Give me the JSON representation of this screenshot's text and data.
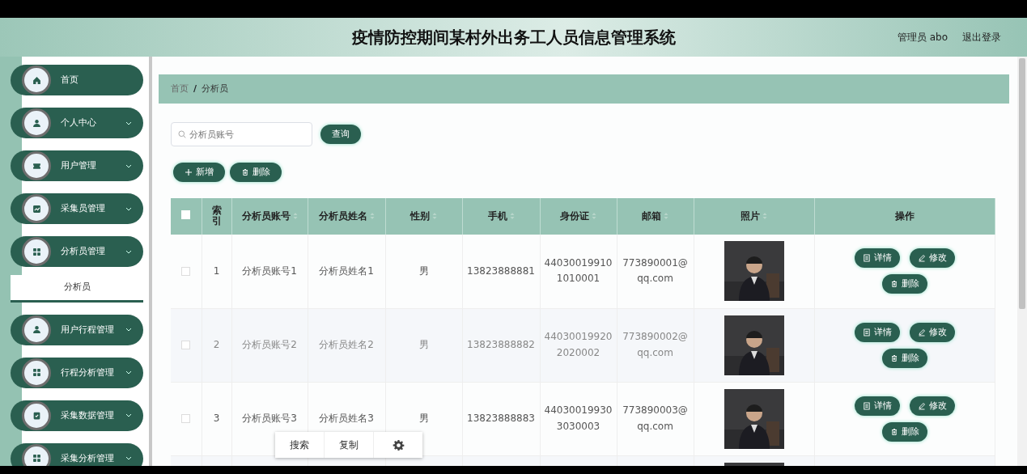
{
  "header": {
    "title": "疫情防控期间某村外出务工人员信息管理系统",
    "user": "管理员 abo",
    "logout": "退出登录"
  },
  "sidebar": {
    "items": [
      {
        "label": "首页",
        "kind": "home",
        "expandable": false
      },
      {
        "label": "个人中心",
        "kind": "user",
        "expandable": true
      },
      {
        "label": "用户管理",
        "kind": "ticket",
        "expandable": true
      },
      {
        "label": "采集员管理",
        "kind": "chart",
        "expandable": true
      },
      {
        "label": "分析员管理",
        "kind": "grid",
        "expandable": true,
        "children": [
          {
            "label": "分析员",
            "selected": true
          }
        ]
      },
      {
        "label": "用户行程管理",
        "kind": "user",
        "expandable": true
      },
      {
        "label": "行程分析管理",
        "kind": "grid",
        "expandable": true
      },
      {
        "label": "采集数据管理",
        "kind": "clipboard",
        "expandable": true
      },
      {
        "label": "采集分析管理",
        "kind": "grid",
        "expandable": true
      }
    ]
  },
  "breadcrumb": {
    "items": [
      "首页",
      "分析员"
    ],
    "separator": "/"
  },
  "search": {
    "placeholder": "分析员账号",
    "button": "查询"
  },
  "toolbar": [
    {
      "kind": "add",
      "label": "新增"
    },
    {
      "kind": "delete",
      "label": "删除"
    }
  ],
  "table": {
    "select_all_checked": false,
    "columns": [
      {
        "kind": "check"
      },
      {
        "kind": "index",
        "label": "索引",
        "sortable": false
      },
      {
        "label": "分析员账号",
        "sortable": true
      },
      {
        "label": "分析员姓名",
        "sortable": true
      },
      {
        "label": "性别",
        "sortable": true
      },
      {
        "label": "手机",
        "sortable": true
      },
      {
        "label": "身份证",
        "sortable": true
      },
      {
        "label": "邮箱",
        "sortable": true
      },
      {
        "label": "照片",
        "sortable": true
      },
      {
        "label": "操作",
        "sortable": false
      }
    ],
    "rows": [
      {
        "checked": false,
        "cells": [
          "",
          "1",
          "分析员账号1",
          "分析员姓名1",
          "男",
          "13823888881",
          "44030019910\n1010001",
          "773890001@\nqq.com"
        ],
        "actions": [
          {
            "kind": "detail",
            "label": "详情"
          },
          {
            "kind": "edit",
            "label": "修改"
          },
          {
            "kind": "delete",
            "label": "删除"
          }
        ]
      },
      {
        "checked": false,
        "cells": [
          "",
          "2",
          "分析员账号2",
          "分析员姓名2",
          "男",
          "13823888882",
          "44030019920\n2020002",
          "773890002@\nqq.com"
        ],
        "actions": [
          {
            "kind": "detail",
            "label": "详情"
          },
          {
            "kind": "edit",
            "label": "修改"
          },
          {
            "kind": "delete",
            "label": "删除"
          }
        ]
      },
      {
        "checked": false,
        "cells": [
          "",
          "3",
          "分析员账号3",
          "分析员姓名3",
          "男",
          "13823888883",
          "44030019930\n3030003",
          "773890003@\nqq.com"
        ],
        "actions": [
          {
            "kind": "detail",
            "label": "详情"
          },
          {
            "kind": "edit",
            "label": "修改"
          },
          {
            "kind": "delete",
            "label": "删除"
          }
        ]
      },
      {
        "cells": []
      }
    ]
  },
  "context_menu": {
    "items": [
      {
        "kind": "text",
        "label": "搜索"
      },
      {
        "kind": "text",
        "label": "复制"
      },
      {
        "kind": "settings"
      }
    ]
  }
}
